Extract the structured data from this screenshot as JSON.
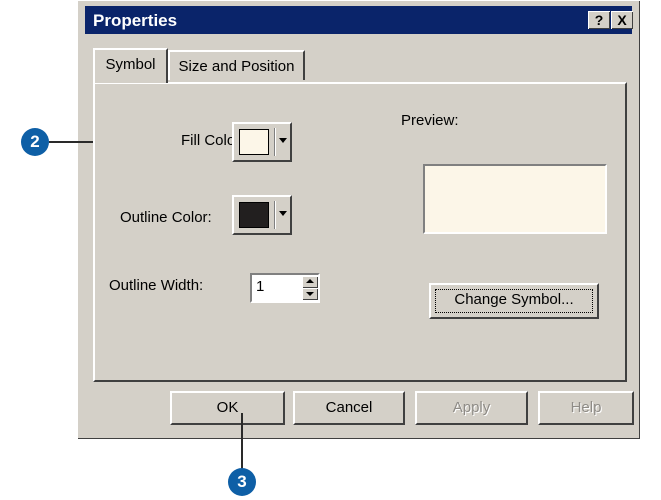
{
  "window": {
    "title": "Properties",
    "help_button": "?",
    "close_button": "X"
  },
  "tabs": [
    {
      "label": "Symbol"
    },
    {
      "label": "Size and Position"
    }
  ],
  "symbol_tab": {
    "fill_color_label": "Fill Color:",
    "outline_color_label": "Outline Color:",
    "outline_width_label": "Outline Width:",
    "outline_width_value": "1",
    "preview_label": "Preview:",
    "change_symbol_label": "Change Symbol..."
  },
  "buttons": {
    "ok": "OK",
    "cancel": "Cancel",
    "apply": "Apply",
    "help": "Help"
  },
  "callouts": [
    "2",
    "3"
  ],
  "colors": {
    "fill_color": "#fcf6e8",
    "outline_color": "#221f1f",
    "titlebar": "#0a246a",
    "callout": "#0e5fa6"
  }
}
